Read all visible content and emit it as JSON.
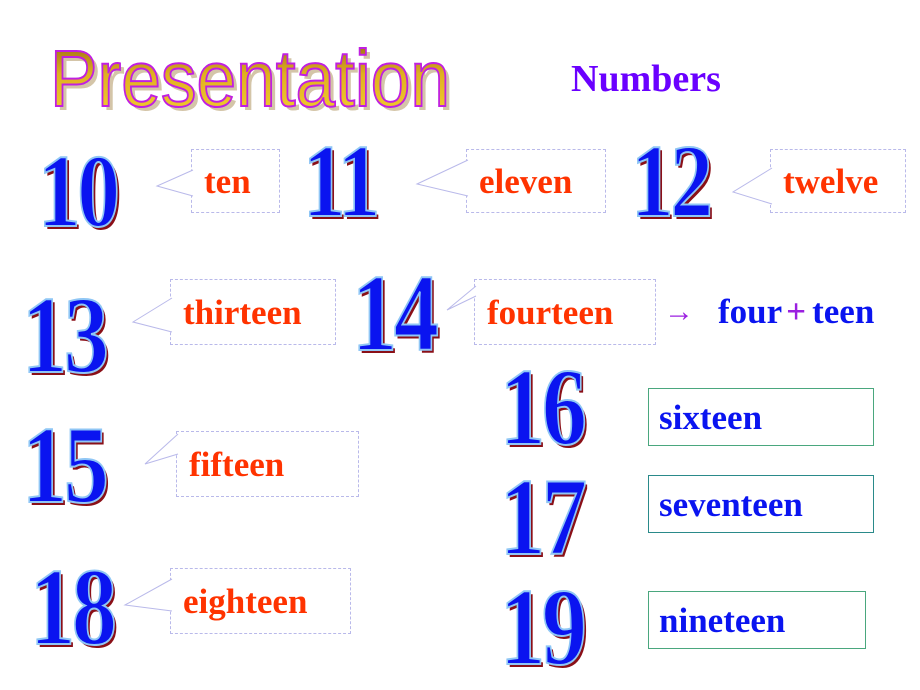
{
  "title": {
    "wordart_text": "Presentation",
    "heading": "Numbers"
  },
  "colors": {
    "numeral_fill": "#0a14f0",
    "numeral_outline": "#8fc6f5",
    "numeral_shadow": "#8a0f17",
    "callout_text": "#ff3300",
    "plain_box_text": "#0a14f0",
    "heading": "#6a00ff",
    "accent_purple": "#9b1fe0",
    "wordart_fill": "#e0b020",
    "wordart_outline": "#c020e0"
  },
  "numbers": [
    {
      "numeral": "10",
      "word": "ten"
    },
    {
      "numeral": "11",
      "word": "eleven"
    },
    {
      "numeral": "12",
      "word": "twelve"
    },
    {
      "numeral": "13",
      "word": "thirteen"
    },
    {
      "numeral": "14",
      "word": "fourteen"
    },
    {
      "numeral": "15",
      "word": "fifteen"
    },
    {
      "numeral": "16",
      "word": "sixteen"
    },
    {
      "numeral": "17",
      "word": "seventeen"
    },
    {
      "numeral": "18",
      "word": "eighteen"
    },
    {
      "numeral": "19",
      "word": "nineteen"
    }
  ],
  "formula": {
    "arrow": "→",
    "part1": "four",
    "plus": "+",
    "part2": "teen"
  }
}
